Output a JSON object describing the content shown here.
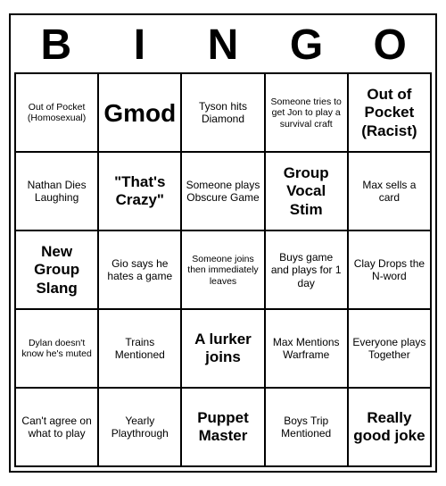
{
  "header": {
    "letters": [
      "B",
      "I",
      "N",
      "G",
      "O"
    ]
  },
  "cells": [
    {
      "text": "Out of Pocket (Homosexual)",
      "size": "small"
    },
    {
      "text": "Gmod",
      "size": "large"
    },
    {
      "text": "Tyson hits Diamond",
      "size": "normal"
    },
    {
      "text": "Someone tries to get Jon to play a survival craft",
      "size": "small"
    },
    {
      "text": "Out of Pocket (Racist)",
      "size": "medium"
    },
    {
      "text": "Nathan Dies Laughing",
      "size": "normal"
    },
    {
      "text": "\"That's Crazy\"",
      "size": "medium"
    },
    {
      "text": "Someone plays Obscure Game",
      "size": "normal"
    },
    {
      "text": "Group Vocal Stim",
      "size": "medium"
    },
    {
      "text": "Max sells a card",
      "size": "normal"
    },
    {
      "text": "New Group Slang",
      "size": "medium"
    },
    {
      "text": "Gio says he hates a game",
      "size": "normal"
    },
    {
      "text": "Someone joins then immediately leaves",
      "size": "small"
    },
    {
      "text": "Buys game and plays for 1 day",
      "size": "normal"
    },
    {
      "text": "Clay Drops the N-word",
      "size": "normal"
    },
    {
      "text": "Dylan doesn't know he's muted",
      "size": "small"
    },
    {
      "text": "Trains Mentioned",
      "size": "normal"
    },
    {
      "text": "A lurker joins",
      "size": "medium"
    },
    {
      "text": "Max Mentions Warframe",
      "size": "normal"
    },
    {
      "text": "Everyone plays Together",
      "size": "normal"
    },
    {
      "text": "Can't agree on what to play",
      "size": "normal"
    },
    {
      "text": "Yearly Playthrough",
      "size": "normal"
    },
    {
      "text": "Puppet Master",
      "size": "medium"
    },
    {
      "text": "Boys Trip Mentioned",
      "size": "normal"
    },
    {
      "text": "Really good joke",
      "size": "medium"
    }
  ]
}
